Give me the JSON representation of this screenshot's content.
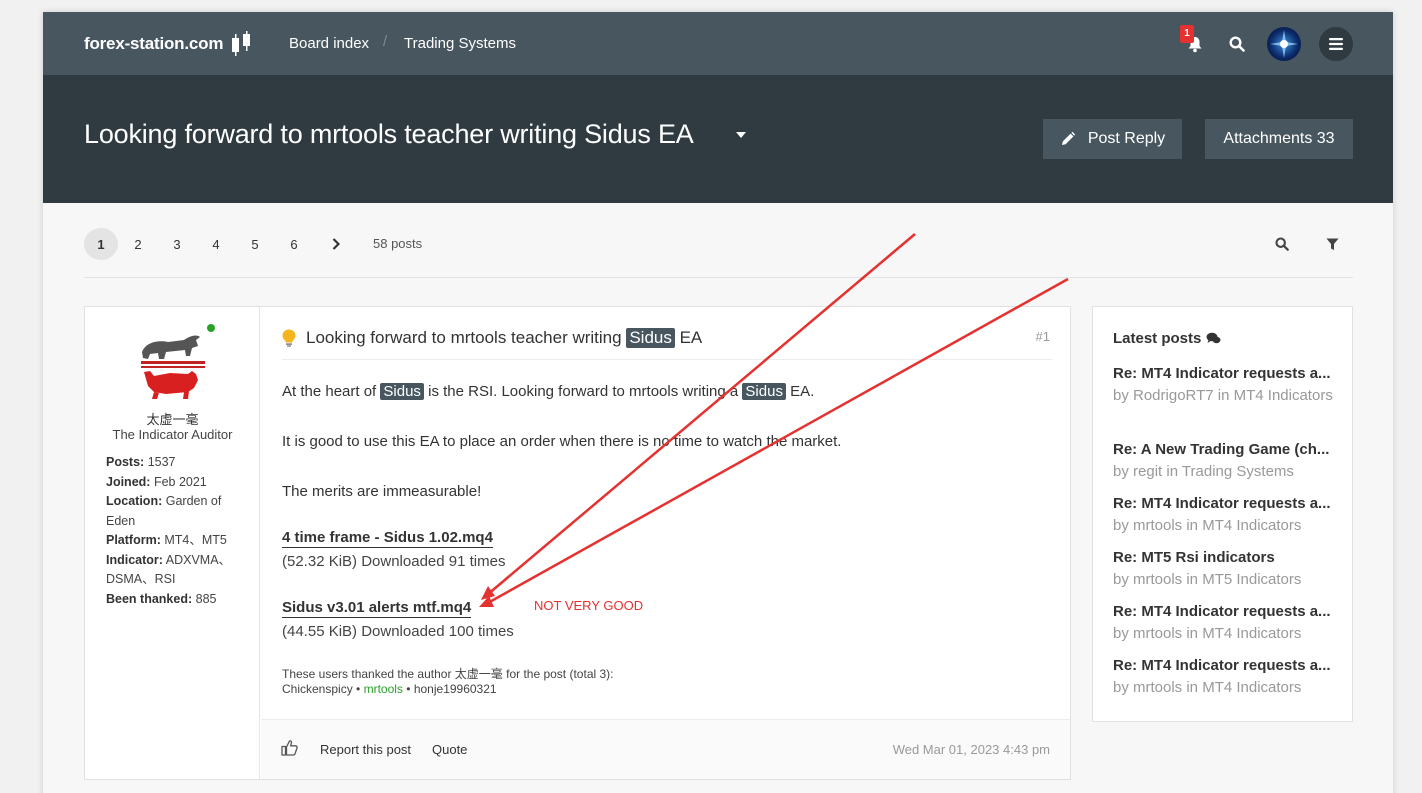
{
  "site": {
    "logo_text": "forex-station.com"
  },
  "nav": {
    "breadcrumbs": [
      "Board index",
      "Trading Systems"
    ],
    "breadcrumb_separator": "/",
    "notification_count": "1",
    "icons": [
      "bell-icon",
      "search-icon",
      "avatar",
      "menu-icon"
    ]
  },
  "topic": {
    "title": "Looking forward to mrtools teacher writing Sidus EA",
    "post_reply_label": "Post Reply",
    "attachments_label": "Attachments 33"
  },
  "pagination": {
    "pages": [
      "1",
      "2",
      "3",
      "4",
      "5",
      "6"
    ],
    "active_page": "1",
    "posts_count": "58 posts"
  },
  "post": {
    "author": {
      "username": "太虚一毫",
      "rank": "The Indicator Auditor",
      "online": true,
      "fields": [
        {
          "label": "Posts:",
          "value": "1537"
        },
        {
          "label": "Joined:",
          "value": "Feb 2021"
        },
        {
          "label": "Location:",
          "value": "Garden of Eden"
        },
        {
          "label": "Platform:",
          "value": "MT4、MT5"
        },
        {
          "label": "Indicator:",
          "value": "ADXVMA、DSMA、RSI"
        },
        {
          "label": "Been thanked:",
          "value": "885"
        }
      ]
    },
    "title_prefix": "Looking forward to mrtools teacher writing",
    "title_highlight": "Sidus",
    "title_suffix": "EA",
    "number": "#1",
    "para1_a": "At the heart of",
    "para1_hl1": "Sidus",
    "para1_b": "is the RSI. Looking forward to mrtools writing a",
    "para1_hl2": "Sidus",
    "para1_c": "EA.",
    "para2": "It is good to use this EA to place an order when there is no time to watch the market.",
    "para3": "The merits are immeasurable!",
    "attachments": [
      {
        "name": "4 time frame - Sidus 1.02.mq4",
        "meta": "(52.32 KiB) Downloaded 91 times"
      },
      {
        "name": "Sidus v3.01 alerts mtf.mq4",
        "meta": "(44.55 KiB) Downloaded 100 times"
      }
    ],
    "annotation": "NOT VERY GOOD",
    "thanks_line": "These users thanked the author 太虚一毫 for the post (total 3):",
    "thanks_users": [
      "Chickenspicy",
      "mrtools",
      "honje19960321"
    ],
    "thanks_sep": "•",
    "report_label": "Report this post",
    "quote_label": "Quote",
    "date": "Wed Mar 01, 2023 4:43 pm"
  },
  "sidebar": {
    "heading": "Latest posts",
    "items": [
      {
        "title": "Re: MT4 Indicator requests a...",
        "meta": "by RodrigoRT7 in MT4 Indicators"
      },
      {
        "title": "Re: A New Trading Game (ch...",
        "meta": "by regit in Trading Systems"
      },
      {
        "title": "Re: MT4 Indicator requests a...",
        "meta": "by mrtools in MT4 Indicators"
      },
      {
        "title": "Re: MT5 Rsi indicators",
        "meta": "by mrtools in MT5 Indicators"
      },
      {
        "title": "Re: MT4 Indicator requests a...",
        "meta": "by mrtools in MT4 Indicators"
      },
      {
        "title": "Re: MT4 Indicator requests a...",
        "meta": "by mrtools in MT4 Indicators"
      }
    ]
  },
  "colors": {
    "topbar": "#47565f",
    "titleband": "#2f3b41",
    "highlight": "#47565f",
    "annotation_red": "#e5312f",
    "online_green": "#2aa02a"
  }
}
